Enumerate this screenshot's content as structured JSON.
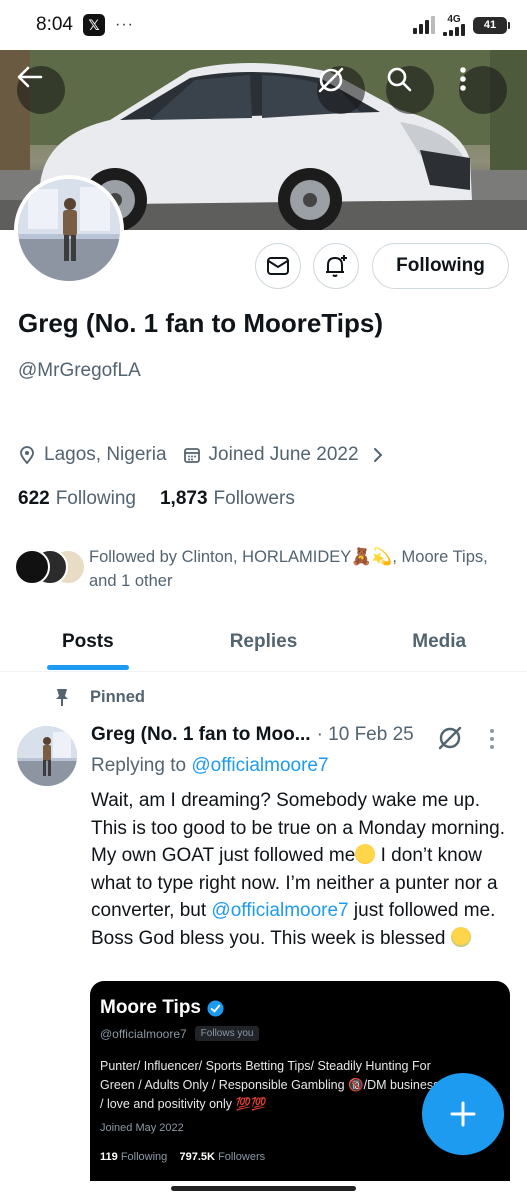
{
  "status_bar": {
    "time": "8:04",
    "app_badge": "𝕏",
    "more": "···",
    "network": "4G",
    "battery": "41"
  },
  "profile": {
    "name": "Greg (No. 1 fan to MooreTips)",
    "handle": "@MrGregofLA",
    "location": "Lagos, Nigeria",
    "joined": "Joined June 2022",
    "following_count": "622",
    "following_label": "Following",
    "followers_count": "1,873",
    "followers_label": "Followers",
    "followed_by": "Followed by Clinton, HORLAMIDEY🧸💫, Moore Tips, and 1 other",
    "follow_button": "Following"
  },
  "tabs": [
    {
      "label": "Posts",
      "active": true
    },
    {
      "label": "Replies",
      "active": false
    },
    {
      "label": "Media",
      "active": false
    }
  ],
  "post": {
    "pinned_label": "Pinned",
    "author": "Greg (No. 1 fan to Moo...",
    "date": "· 10 Feb 25",
    "replying_prefix": "Replying to",
    "replying_to": "@officialmoore7",
    "text_1": "Wait, am I dreaming? Somebody wake me up. This is too good to be true on a Monday morning. My own GOAT just followed me",
    "text_2": " I don’t know what to type right now. I’m neither a punter nor a converter, but ",
    "text_mention": "@officialmoore7",
    "text_3": " just followed me. Boss God bless you. This week is blessed "
  },
  "embed": {
    "name": "Moore Tips",
    "handle": "@officialmoore7",
    "follows_you": "Follows you",
    "bio": "Punter/ Influencer/ Sports Betting Tips/ Steadily Hunting For Green / Adults Only / Responsible Gambling 🔞/DM business / love and positivity only 💯💯",
    "joined": "Joined May 2022",
    "following_count": "119",
    "following_label": "Following",
    "followers_count": "797.5K",
    "followers_label": "Followers"
  },
  "colors": {
    "accent": "#1d9bf0",
    "text_primary": "#0f1419",
    "text_secondary": "#536471"
  }
}
